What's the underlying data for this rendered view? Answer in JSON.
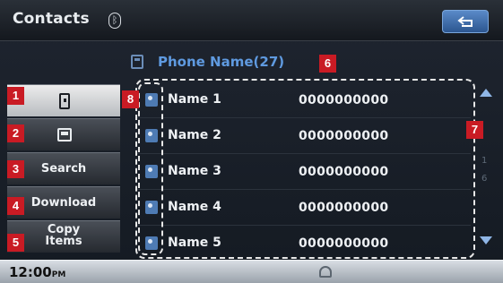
{
  "header": {
    "title": "Contacts",
    "bluetooth_glyph": "ᛒ"
  },
  "phone": {
    "name": "Phone Name(27)"
  },
  "menu": {
    "contacts_icon": "contact-card-icon",
    "phonebook_icon": "phone-book-icon",
    "search_label": "Search",
    "download_label": "Download",
    "copy_line1": "Copy",
    "copy_line2": "Items"
  },
  "contacts": [
    {
      "name": "Name 1",
      "number": "0000000000"
    },
    {
      "name": "Name 2",
      "number": "0000000000"
    },
    {
      "name": "Name 3",
      "number": "0000000000"
    },
    {
      "name": "Name 4",
      "number": "0000000000"
    },
    {
      "name": "Name 5",
      "number": "0000000000"
    }
  ],
  "scroll": {
    "page_current": "1",
    "page_total": "6"
  },
  "status": {
    "time": "12:00",
    "meridiem": "PM"
  },
  "callouts": [
    "1",
    "2",
    "3",
    "4",
    "5",
    "6",
    "7",
    "8"
  ],
  "colors": {
    "callout": "#c91b24",
    "accent": "#5f9ae0"
  }
}
